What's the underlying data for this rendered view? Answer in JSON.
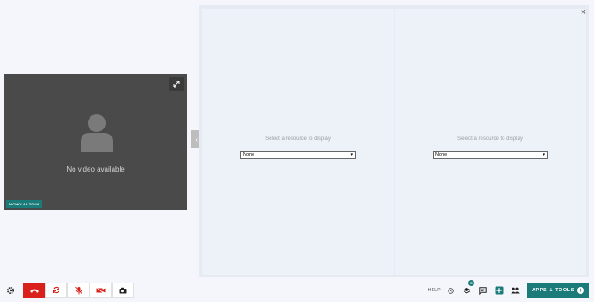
{
  "video": {
    "no_video_text": "No video available",
    "participant_name": "NICHOLAS TONY"
  },
  "content": {
    "left_pane": {
      "prompt": "Select a resource to display",
      "selected": "None"
    },
    "right_pane": {
      "prompt": "Select a resource to display",
      "selected": "None"
    }
  },
  "bottom_bar": {
    "help_label": "HELP",
    "notification_count": "3",
    "apps_tools_label": "APPS & TOOLS",
    "apps_plus": "+"
  },
  "colors": {
    "accent": "#1a7b78",
    "end_call": "#d9201b",
    "video_bg": "#4a4a4a"
  }
}
